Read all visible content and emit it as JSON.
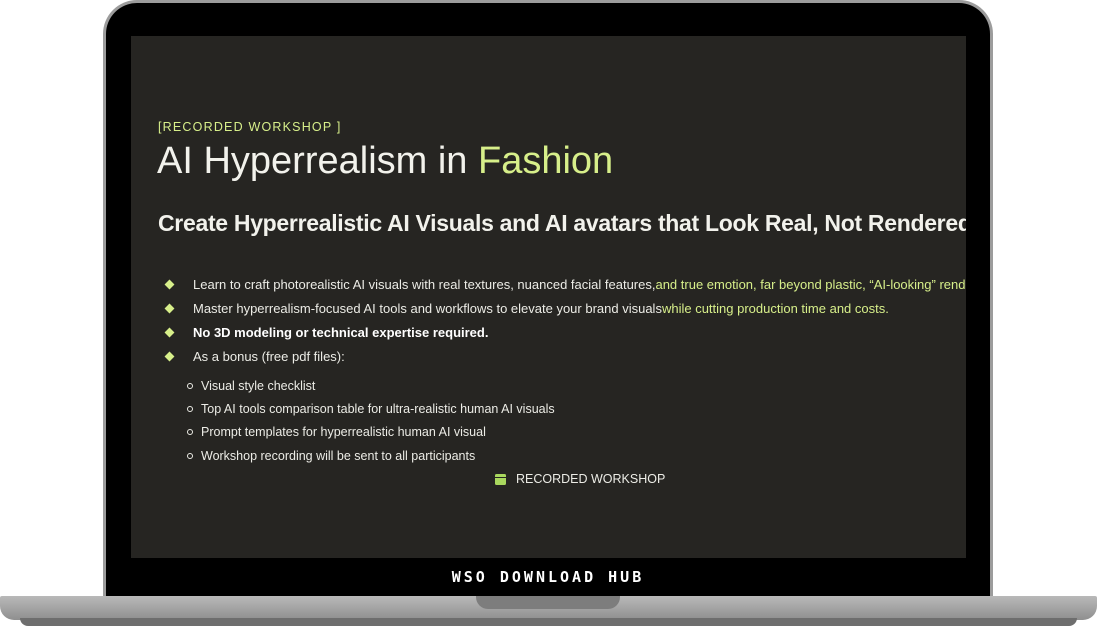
{
  "workshop": {
    "eyebrow": "[RECORDED WORKSHOP ]",
    "title_main": "AI Hyperrealism in ",
    "title_accent": "Fashion",
    "subtitle": "Create Hyperrealistic AI Visuals and AI avatars that Look Real, Not Rendered",
    "bullets": [
      {
        "text": "Learn to craft photorealistic AI visuals with real textures, nuanced facial features, ",
        "highlight": "and true emotion, far beyond plastic, “AI-looking” renders."
      },
      {
        "text": "Master hyperrealism-focused AI tools and workflows to elevate your brand visuals ",
        "highlight": "while cutting production time and costs."
      },
      {
        "text": "No 3D modeling or technical expertise required."
      },
      {
        "text": "As a bonus (free pdf files):"
      }
    ],
    "bonus_items": [
      "Visual style checklist",
      "Top AI tools comparison table for ultra-realistic human AI visuals",
      "Prompt templates for hyperrealistic human AI visual",
      "Workshop recording will be sent to all participants"
    ],
    "format_tag": "RECORDED WORKSHOP",
    "format_icon": "calendar-icon"
  },
  "brand": {
    "banner": "WSO DOWNLOAD HUB"
  },
  "colors": {
    "screen_bg": "#262522",
    "accent": "#d7ef8a",
    "text": "#f2f2ec"
  }
}
